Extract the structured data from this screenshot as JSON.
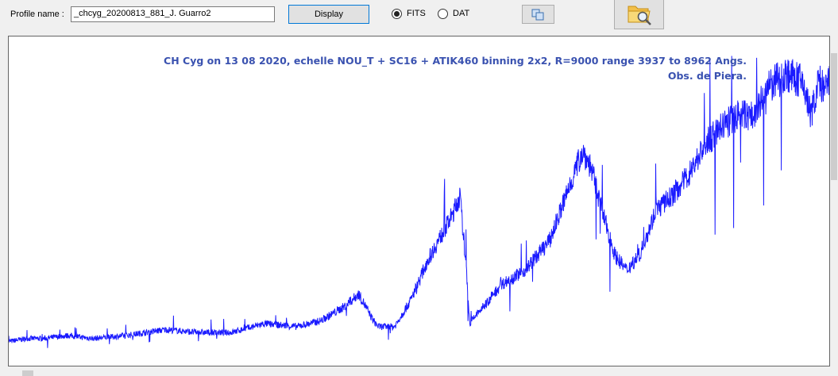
{
  "toolbar": {
    "profile_label": "Profile name :",
    "profile_value": "_chcyg_20200813_881_J. Guarro2",
    "display_label": "Display",
    "radio_fits": "FITS",
    "radio_dat": "DAT",
    "selected_format": "FITS",
    "copy_icon": "copy-icon",
    "folder_icon": "folder-search-icon"
  },
  "colors": {
    "spectrum": "#1a1aff",
    "title": "#3a52b0"
  },
  "chart_data": {
    "type": "line",
    "title_line1": "CH Cyg on 13 08 2020,  echelle NOU_T  +  SC16  +  ATIK460 binning 2x2,  R=9000  range 3937 to 8962 Angs.",
    "title_line2": "Obs. de Piera.",
    "xlabel": "",
    "ylabel": "",
    "xlim": [
      3937,
      8962
    ],
    "ylim": [
      0,
      1
    ],
    "grid": false,
    "series": [
      {
        "x": [
          3937,
          4050,
          4150,
          4300,
          4450,
          4650,
          4900,
          5100,
          5300,
          5500,
          5700,
          5850,
          6000,
          6080,
          6130,
          6170,
          6200,
          6300,
          6400,
          6500,
          6650,
          6700,
          6740,
          6760,
          6800,
          6850,
          6950,
          7100,
          7250,
          7350,
          7450,
          7500,
          7580,
          7650,
          7720,
          7800,
          7900,
          8000,
          8100,
          8200,
          8300,
          8400,
          8500,
          8600,
          8700,
          8800,
          8850,
          8900,
          8930,
          8962
        ],
        "values": [
          0.06,
          0.07,
          0.07,
          0.08,
          0.07,
          0.08,
          0.1,
          0.09,
          0.09,
          0.12,
          0.11,
          0.13,
          0.18,
          0.22,
          0.17,
          0.13,
          0.11,
          0.11,
          0.2,
          0.33,
          0.48,
          0.55,
          0.3,
          0.12,
          0.15,
          0.18,
          0.25,
          0.3,
          0.4,
          0.55,
          0.7,
          0.65,
          0.48,
          0.35,
          0.3,
          0.35,
          0.5,
          0.55,
          0.62,
          0.72,
          0.78,
          0.82,
          0.82,
          0.92,
          0.96,
          0.93,
          0.82,
          0.94,
          0.9,
          0.93
        ]
      }
    ]
  }
}
